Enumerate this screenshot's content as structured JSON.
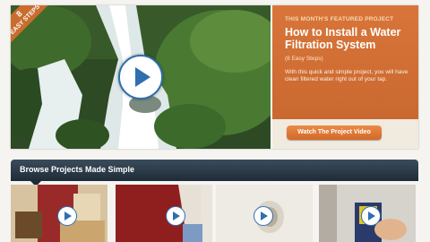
{
  "hero": {
    "badge": {
      "number": "8",
      "text": "EASY STEPS"
    },
    "feature_label": "THIS MONTH'S FEATURED PROJECT",
    "title": "How to Install a Water Filtration System",
    "steps": "(8 Easy Steps)",
    "description": "With this quick and simple project, you will have clean filtered water right out of your tap.",
    "watch_button": "Watch The Project Video"
  },
  "browse": {
    "title": "Browse Projects Made Simple"
  },
  "thumbnails": [
    {
      "name": "living-room"
    },
    {
      "name": "painting-wall"
    },
    {
      "name": "drywall-hole"
    },
    {
      "name": "caulking"
    }
  ],
  "colors": {
    "accent_orange": "#c96d2e",
    "play_blue": "#2e6fb0",
    "browse_bar": "#2b3a48"
  }
}
